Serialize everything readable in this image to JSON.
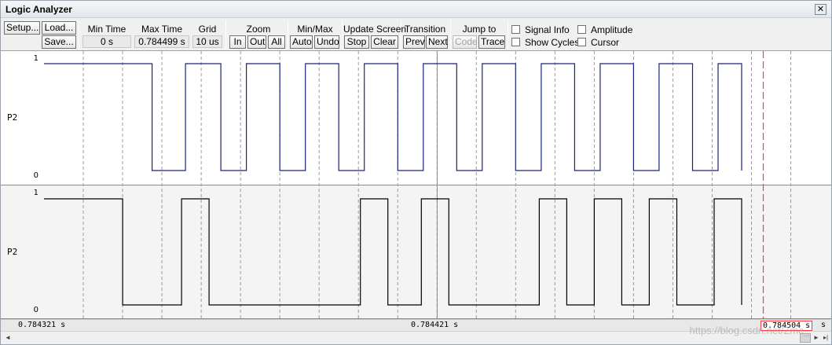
{
  "window": {
    "title": "Logic Analyzer",
    "close_glyph": "✕"
  },
  "toolbar": {
    "setup_label": "Setup...",
    "load_label": "Load...",
    "save_label": "Save...",
    "min_time": {
      "label": "Min Time",
      "value": "0 s"
    },
    "max_time": {
      "label": "Max Time",
      "value": "0.784499 s"
    },
    "grid": {
      "label": "Grid",
      "value": "10 us"
    },
    "zoom": {
      "label": "Zoom",
      "in": "In",
      "out": "Out",
      "all": "All"
    },
    "minmax": {
      "label": "Min/Max",
      "auto": "Auto",
      "undo": "Undo"
    },
    "update_screen": {
      "label": "Update Screen",
      "stop": "Stop",
      "clear": "Clear"
    },
    "transition": {
      "label": "Transition",
      "prev": "Prev",
      "next": "Next"
    },
    "jump_to": {
      "label": "Jump to",
      "code": "Code",
      "trace": "Trace"
    },
    "options": {
      "signal_info": "Signal Info",
      "show_cycles": "Show Cycles",
      "amplitude": "Amplitude",
      "cursor": "Cursor"
    }
  },
  "signals": [
    {
      "name": "P2",
      "y_high": "1",
      "y_low": "0",
      "color": "#1a237e",
      "start_level": 1,
      "transitions_us": [
        27.5,
        36,
        45,
        51.5,
        60,
        66.5,
        75,
        81.5,
        90,
        96.5,
        105,
        111.5,
        120,
        126.5,
        135,
        141.5,
        150,
        156.5,
        165,
        171.5,
        177.5
      ]
    },
    {
      "name": "P2",
      "y_high": "1",
      "y_low": "0",
      "color": "#000000",
      "start_level": 1,
      "transitions_us": [
        20,
        35,
        42,
        80.5,
        87.5,
        96,
        103,
        126,
        133,
        140,
        147,
        154,
        161,
        170.5,
        177.5
      ]
    }
  ],
  "axis": {
    "start_us": 0,
    "end_us": 177.5,
    "grid_us": 10
  },
  "timebar": {
    "left_time": "0.784321 s",
    "mid_time": "0.784421 s",
    "right_time": "0.784504 s",
    "right_clipped": "s"
  },
  "cursor": {
    "color": "#ff3b3b",
    "time_us": 183
  },
  "playhead": {
    "time_us": 100
  },
  "scrollbar": {
    "left_arrow": "◄",
    "right_arrow": "►",
    "end_marker": "▸|"
  },
  "watermark": "https://blog.csdn.net/Zmc_"
}
